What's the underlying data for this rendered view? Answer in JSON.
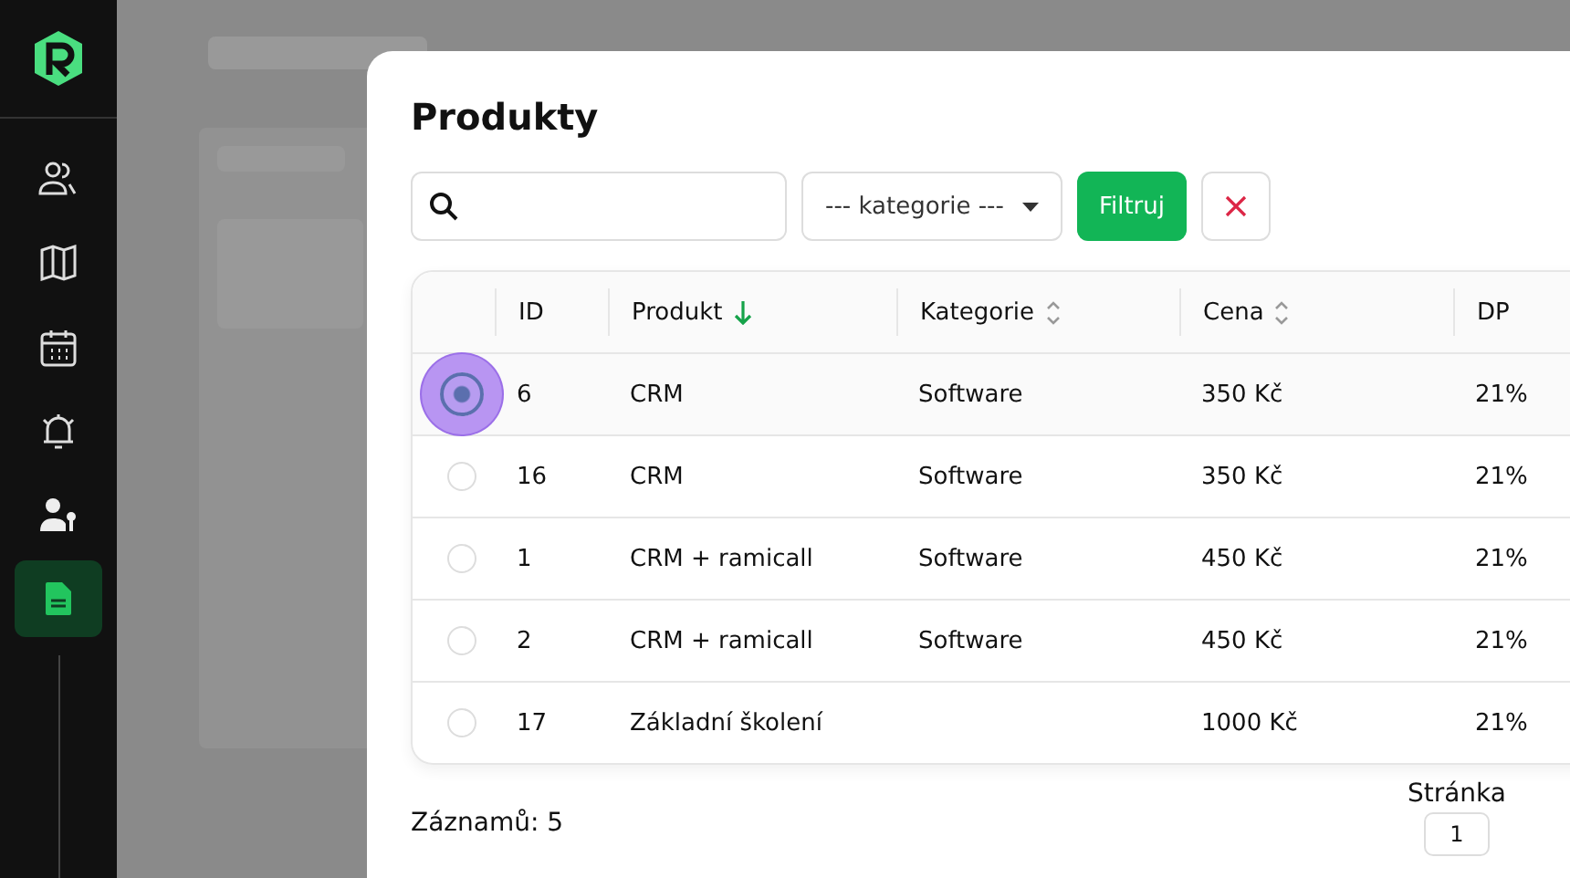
{
  "sidebar": {
    "items": [
      {
        "selected": false
      },
      {
        "selected": false
      },
      {
        "selected": false
      },
      {
        "selected": false
      },
      {
        "selected": false
      },
      {
        "selected": true
      }
    ]
  },
  "modal": {
    "title": "Produkty",
    "category_select": {
      "value": "--- kategorie ---"
    },
    "filter_button": "Filtruj",
    "table": {
      "columns": [
        {
          "label": "ID",
          "kind": "plain"
        },
        {
          "label": "Produkt",
          "kind": "sorted"
        },
        {
          "label": "Kategorie",
          "kind": "sortable"
        },
        {
          "label": "Cena",
          "kind": "sortable"
        },
        {
          "label": "DP",
          "kind": "plain"
        }
      ],
      "rows": [
        {
          "selected": true,
          "cells": [
            "6",
            "CRM",
            "Software",
            "350 Kč",
            "21%"
          ]
        },
        {
          "selected": false,
          "cells": [
            "16",
            "CRM",
            "Software",
            "350 Kč",
            "21%"
          ]
        },
        {
          "selected": false,
          "cells": [
            "1",
            "CRM + ramicall",
            "Software",
            "450 Kč",
            "21%"
          ]
        },
        {
          "selected": false,
          "cells": [
            "2",
            "CRM + ramicall",
            "Software",
            "450 Kč",
            "21%"
          ]
        },
        {
          "selected": false,
          "cells": [
            "17",
            "Základní školení",
            "",
            "1000 Kč",
            "21%"
          ]
        }
      ]
    },
    "records": "Záznamů: 5",
    "page_label": "Stránka",
    "page_value": "1"
  }
}
